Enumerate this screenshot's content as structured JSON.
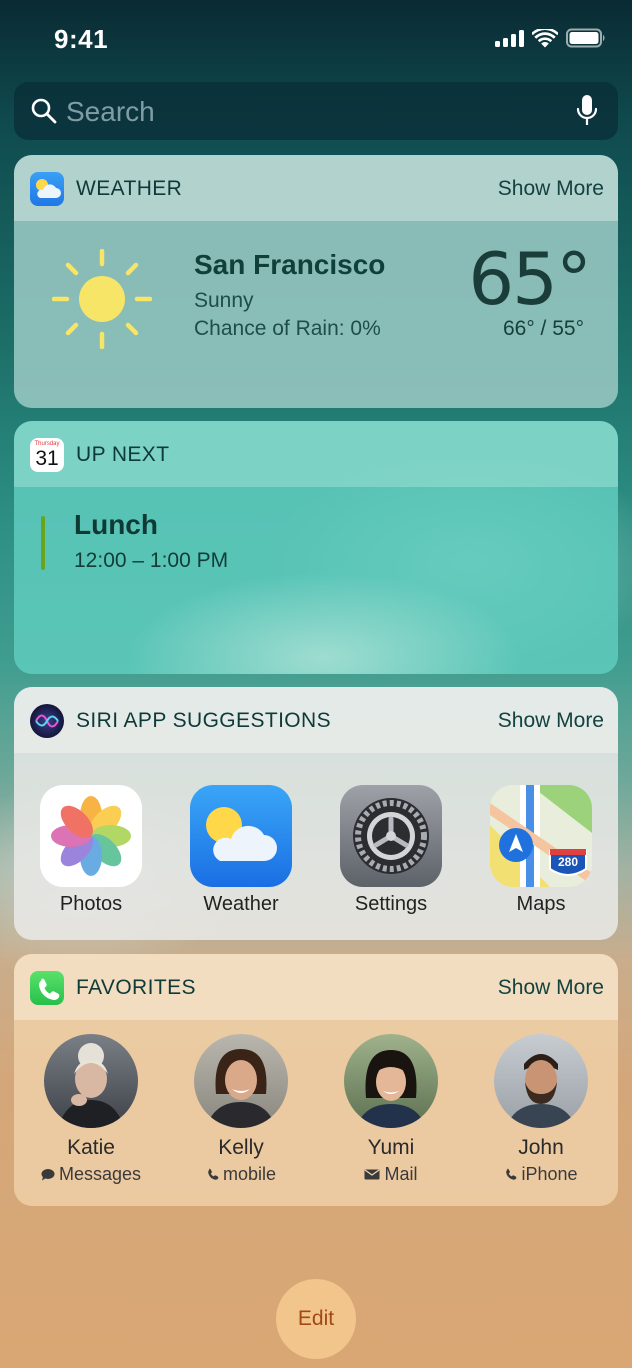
{
  "status_bar": {
    "time": "9:41"
  },
  "search": {
    "placeholder": "Search"
  },
  "weather_widget": {
    "title": "WEATHER",
    "show_more": "Show More",
    "city": "San Francisco",
    "condition": "Sunny",
    "rain": "Chance of Rain: 0%",
    "temperature": "65°",
    "hi_lo": "66° / 55°"
  },
  "upnext_widget": {
    "title": "UP NEXT",
    "calendar_icon": {
      "weekday": "Thursday",
      "day": "31"
    },
    "event": {
      "title": "Lunch",
      "time": "12:00 – 1:00 PM",
      "color": "#6aa41f"
    }
  },
  "siri_widget": {
    "title": "SIRI APP SUGGESTIONS",
    "show_more": "Show More",
    "apps": [
      {
        "label": "Photos",
        "icon": "photos-icon"
      },
      {
        "label": "Weather",
        "icon": "weather-app-icon"
      },
      {
        "label": "Settings",
        "icon": "settings-icon"
      },
      {
        "label": "Maps",
        "icon": "maps-icon",
        "badge": "280"
      }
    ]
  },
  "favorites_widget": {
    "title": "FAVORITES",
    "show_more": "Show More",
    "contacts": [
      {
        "name": "Katie",
        "method": "Messages",
        "method_icon": "message-bubble-icon"
      },
      {
        "name": "Kelly",
        "method": "mobile",
        "method_icon": "phone-icon"
      },
      {
        "name": "Yumi",
        "method": "Mail",
        "method_icon": "mail-icon"
      },
      {
        "name": "John",
        "method": "iPhone",
        "method_icon": "phone-icon"
      }
    ]
  },
  "edit_button": {
    "label": "Edit"
  },
  "colors": {
    "accent_edit": "#a14a15",
    "event_bar": "#6aa41f"
  }
}
